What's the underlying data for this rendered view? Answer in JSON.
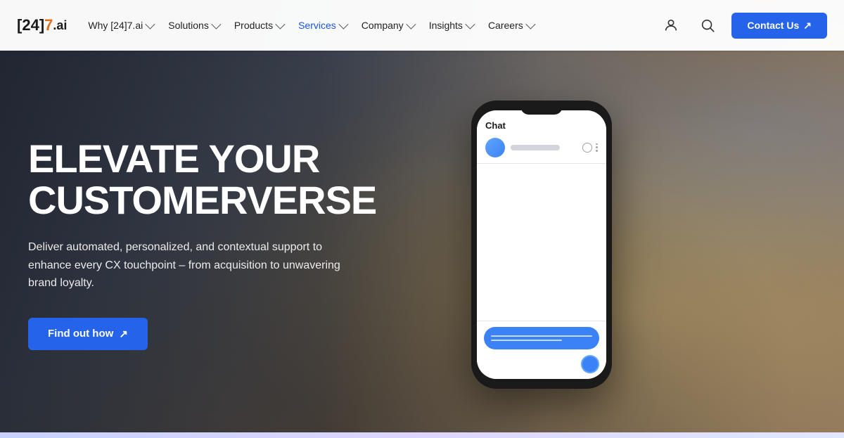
{
  "brand": {
    "logo_bracket_open": "[",
    "logo_24": "24",
    "logo_bracket_close": "]",
    "logo_seven": "7",
    "logo_dot_ai": ".ai"
  },
  "navbar": {
    "items": [
      {
        "id": "why",
        "label": "Why [24]7.ai",
        "has_dropdown": true
      },
      {
        "id": "solutions",
        "label": "Solutions",
        "has_dropdown": true
      },
      {
        "id": "products",
        "label": "Products",
        "has_dropdown": true
      },
      {
        "id": "services",
        "label": "Services",
        "has_dropdown": true
      },
      {
        "id": "company",
        "label": "Company",
        "has_dropdown": true
      },
      {
        "id": "insights",
        "label": "Insights",
        "has_dropdown": true
      },
      {
        "id": "careers",
        "label": "Careers",
        "has_dropdown": true
      }
    ],
    "contact_button": "Contact Us"
  },
  "hero": {
    "title_line1": "ELEVATE YOUR",
    "title_line2": "CUSTOMERVERSE",
    "subtitle": "Deliver automated, personalized, and contextual support to enhance every CX touchpoint – from acquisition to unwavering brand loyalty.",
    "cta_label": "Find out how"
  },
  "phone": {
    "chat_title": "Chat"
  }
}
